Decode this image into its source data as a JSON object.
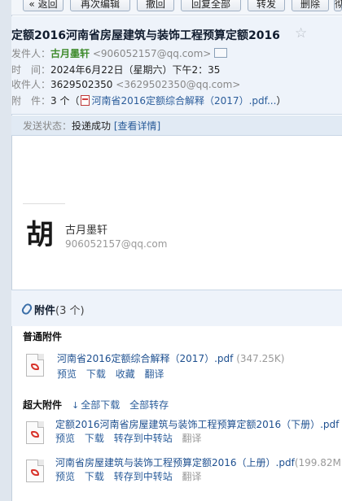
{
  "toolbar": {
    "back": "« 返回",
    "edit_again": "再次编辑",
    "recall": "撤回",
    "reply_all": "回复全部",
    "forward": "转发",
    "delete": "删除",
    "more": "彻"
  },
  "mail": {
    "subject": "定额2016河南省房屋建筑与装饰工程预算定额2016",
    "star": "☆",
    "from_label": "发件人：",
    "from_name": "古月墨轩",
    "from_addr": "<906052157@qq.com>",
    "time_label": "时　间：",
    "time_value": "2024年6月22日（星期六）下午2：35",
    "to_label": "收件人：",
    "to_name": "3629502350",
    "to_addr": "<3629502350@qq.com>",
    "attach_label": "附　件：",
    "attach_count": "3 个",
    "attach_open": "（",
    "attach_preview": "河南省2016定额综合解释（2017）.pdf...",
    "attach_close": "）"
  },
  "status": {
    "label": "发送状态：",
    "value": "投递成功",
    "detail_link": "[查看详情]"
  },
  "signature": {
    "glyph": "胡",
    "name": "古月墨轩",
    "email": "906052157@qq.com"
  },
  "attachments": {
    "title": "附件",
    "count": "(3 个)",
    "normal_label": "普通附件",
    "normal": [
      {
        "name": "河南省2016定额综合解释（2017）.pdf",
        "size": "(347.25K)",
        "actions": [
          "预览",
          "下载",
          "收藏",
          "翻译"
        ]
      }
    ],
    "super_label": "超大附件",
    "download_all": "全部下载",
    "save_all": "全部转存",
    "super": [
      {
        "name": "定额2016河南省房屋建筑与装饰工程预算定额2016（下册）.pdf",
        "size": "",
        "actions": [
          "预览",
          "下载",
          "转存到中转站",
          "翻译"
        ]
      },
      {
        "name": "河南省房屋建筑与装饰工程预算定额2016（上册）.pdf",
        "size": "(199.82M",
        "actions": [
          "预览",
          "下载",
          "转存到中转站",
          "翻译"
        ]
      }
    ]
  }
}
